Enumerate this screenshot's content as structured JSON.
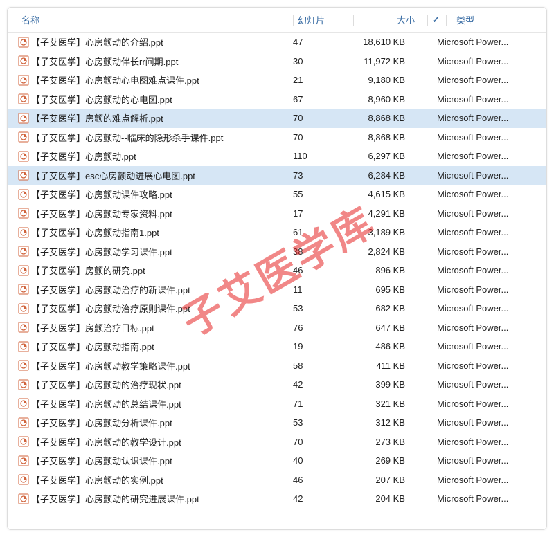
{
  "watermark": "子艾医学库",
  "header": {
    "name": "名称",
    "slides": "幻灯片",
    "size": "大小",
    "check": "✓",
    "type": "类型"
  },
  "typeLabel": "Microsoft Power...",
  "files": [
    {
      "name": "【子艾医学】心房颤动的介绍.ppt",
      "slides": "47",
      "size": "18,610 KB",
      "selected": false
    },
    {
      "name": "【子艾医学】心房颤动伴长rr间期.ppt",
      "slides": "30",
      "size": "11,972 KB",
      "selected": false
    },
    {
      "name": "【子艾医学】心房颤动心电图难点课件.ppt",
      "slides": "21",
      "size": "9,180 KB",
      "selected": false
    },
    {
      "name": "【子艾医学】心房颤动的心电图.ppt",
      "slides": "67",
      "size": "8,960 KB",
      "selected": false
    },
    {
      "name": "【子艾医学】房颤的难点解析.ppt",
      "slides": "70",
      "size": "8,868 KB",
      "selected": true
    },
    {
      "name": "【子艾医学】心房颤动--临床的隐形杀手课件.ppt",
      "slides": "70",
      "size": "8,868 KB",
      "selected": false
    },
    {
      "name": "【子艾医学】心房颤动.ppt",
      "slides": "110",
      "size": "6,297 KB",
      "selected": false
    },
    {
      "name": "【子艾医学】esc心房颤动进展心电图.ppt",
      "slides": "73",
      "size": "6,284 KB",
      "selected": true
    },
    {
      "name": "【子艾医学】心房颤动课件攻略.ppt",
      "slides": "55",
      "size": "4,615 KB",
      "selected": false
    },
    {
      "name": "【子艾医学】心房颤动专家资料.ppt",
      "slides": "17",
      "size": "4,291 KB",
      "selected": false
    },
    {
      "name": "【子艾医学】心房颤动指南1.ppt",
      "slides": "61",
      "size": "3,189 KB",
      "selected": false
    },
    {
      "name": "【子艾医学】心房颤动学习课件.ppt",
      "slides": "38",
      "size": "2,824 KB",
      "selected": false
    },
    {
      "name": "【子艾医学】房颤的研究.ppt",
      "slides": "46",
      "size": "896 KB",
      "selected": false
    },
    {
      "name": "【子艾医学】心房颤动治疗的新课件.ppt",
      "slides": "11",
      "size": "695 KB",
      "selected": false
    },
    {
      "name": "【子艾医学】心房颤动治疗原则课件.ppt",
      "slides": "53",
      "size": "682 KB",
      "selected": false
    },
    {
      "name": "【子艾医学】房颤治疗目标.ppt",
      "slides": "76",
      "size": "647 KB",
      "selected": false
    },
    {
      "name": "【子艾医学】心房颤动指南.ppt",
      "slides": "19",
      "size": "486 KB",
      "selected": false
    },
    {
      "name": "【子艾医学】心房颤动教学策略课件.ppt",
      "slides": "58",
      "size": "411 KB",
      "selected": false
    },
    {
      "name": "【子艾医学】心房颤动的治疗现状.ppt",
      "slides": "42",
      "size": "399 KB",
      "selected": false
    },
    {
      "name": "【子艾医学】心房颤动的总结课件.ppt",
      "slides": "71",
      "size": "321 KB",
      "selected": false
    },
    {
      "name": "【子艾医学】心房颤动分析课件.ppt",
      "slides": "53",
      "size": "312 KB",
      "selected": false
    },
    {
      "name": "【子艾医学】心房颤动的教学设计.ppt",
      "slides": "70",
      "size": "273 KB",
      "selected": false
    },
    {
      "name": "【子艾医学】心房颤动认识课件.ppt",
      "slides": "40",
      "size": "269 KB",
      "selected": false
    },
    {
      "name": "【子艾医学】心房颤动的实例.ppt",
      "slides": "46",
      "size": "207 KB",
      "selected": false
    },
    {
      "name": "【子艾医学】心房颤动的研究进展课件.ppt",
      "slides": "42",
      "size": "204 KB",
      "selected": false
    }
  ]
}
